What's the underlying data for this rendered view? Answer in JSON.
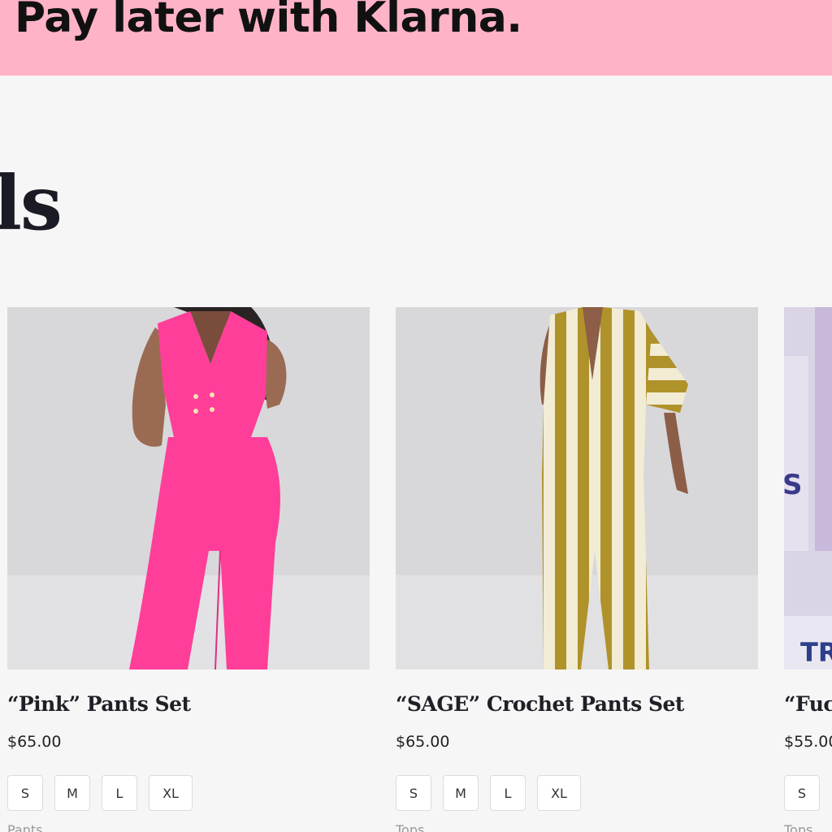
{
  "banner": {
    "text": "Pay later with Klarna."
  },
  "section": {
    "heading": "ls"
  },
  "products": [
    {
      "title": "“Pink” Pants Set",
      "price": "$65.00",
      "sizes": [
        "S",
        "M",
        "L",
        "XL"
      ],
      "category": "Pants"
    },
    {
      "title": "“SAGE” Crochet Pants Set",
      "price": "$65.00",
      "sizes": [
        "S",
        "M",
        "L",
        "XL"
      ],
      "category": "Tops"
    },
    {
      "title": "“Fuc",
      "price": "$55.00",
      "sizes": [
        "S"
      ],
      "category": "Tops",
      "image_text": "S",
      "image_text_2": "TR"
    }
  ],
  "colors": {
    "banner": "#ffb3c6",
    "page_bg": "#f6f6f6",
    "pink_outfit": "#ff3e9a",
    "sage_stripe": "#b0922a"
  }
}
